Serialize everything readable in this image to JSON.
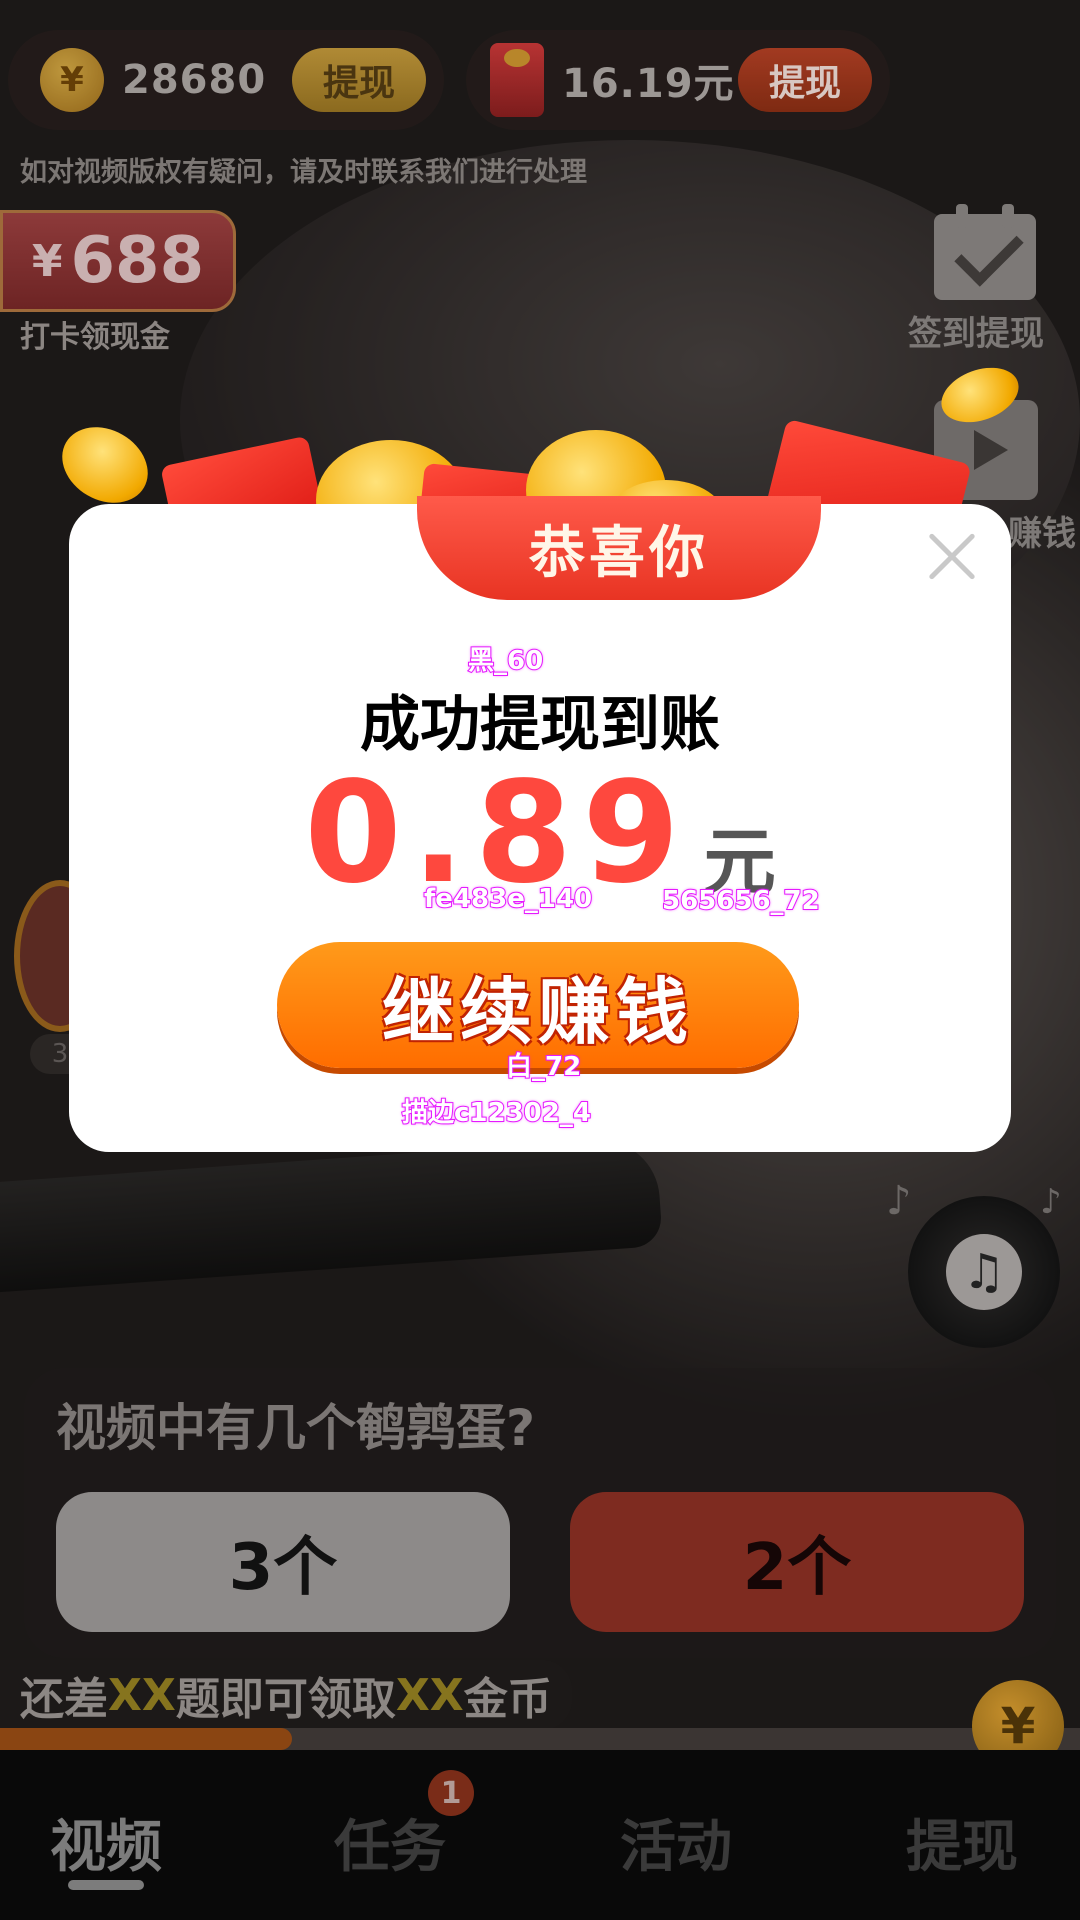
{
  "wallet": {
    "coins": "28680",
    "coin_withdraw_label": "提现",
    "cash_amount": "16.19元",
    "cash_withdraw_label": "提现"
  },
  "notice": "如对视频版权有疑问，请及时联系我们进行处理",
  "checkin_badge": {
    "currency": "¥",
    "amount": "688",
    "label": "打卡领现金"
  },
  "side_actions": [
    {
      "label": "签到提现",
      "icon": "calendar-check-icon"
    },
    {
      "label": "赚钱",
      "icon": "play-video-icon"
    }
  ],
  "left_partial_tag": "3",
  "modal": {
    "ribbon_title": "恭喜你",
    "title": "成功提现到账",
    "amount": "0.89",
    "unit": "元",
    "continue_label": "继续赚钱",
    "annotations": {
      "title": "黑_60",
      "amount": "fe483e_140",
      "unit": "565656_72",
      "button_text": "白_72",
      "button_stroke": "描边c12302_4"
    }
  },
  "quiz": {
    "question": "视频中有几个鹌鹑蛋?",
    "options": [
      "3个",
      "2个"
    ]
  },
  "progress": {
    "prefix": "还差",
    "count": "XX",
    "middle": "题即可领取",
    "reward": "XX",
    "suffix": "金币",
    "fill_fraction": 0.27
  },
  "nav": {
    "items": [
      "视频",
      "任务",
      "活动",
      "提现"
    ],
    "active_index": 0,
    "task_badge": "1"
  },
  "colors": {
    "amount": "#fe483e",
    "unit": "#565656",
    "button": "#ff7a00",
    "button_stroke": "#c12302",
    "ribbon": "#e83423"
  }
}
